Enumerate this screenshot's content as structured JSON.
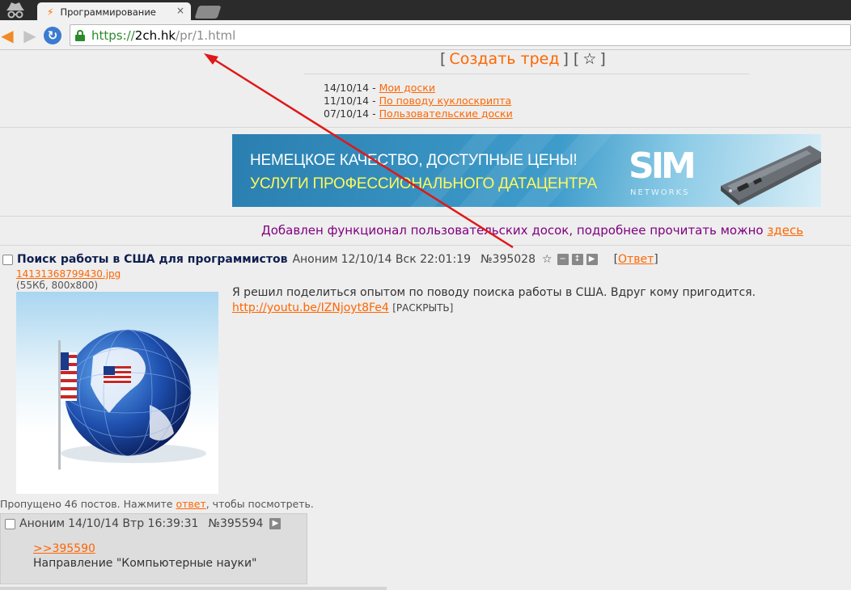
{
  "browser": {
    "tab_title": "Программирование",
    "tab_close": "×",
    "url_scheme": "https://",
    "url_host": "2ch.hk",
    "url_path": "/pr/1.html",
    "icons": {
      "back": "back-arrow-icon",
      "forward": "forward-arrow-icon",
      "reload": "reload-icon",
      "lock": "lock-icon",
      "incognito": "incognito-icon"
    }
  },
  "header": {
    "bracket_open": "[",
    "create_thread": "Создать тред",
    "bracket_mid": "] [",
    "star": "☆",
    "bracket_close": "]"
  },
  "news": [
    {
      "date": "14/10/14 - ",
      "title": "Мои доски"
    },
    {
      "date": "11/10/14 - ",
      "title": "По поводу куклоскрипта"
    },
    {
      "date": "07/10/14 - ",
      "title": "Пользовательские доски"
    }
  ],
  "banner": {
    "line1": "НЕМЕЦКОЕ КАЧЕСТВО, ДОСТУПНЫЕ ЦЕНЫ!",
    "line2": "УСЛУГИ ПРОФЕССИОНАЛЬНОГО ДАТАЦЕНТРА",
    "logo": "SIM",
    "logo_sub": "NETWORKS"
  },
  "announcement": {
    "text": "Добавлен функционал пользовательских досок, подробнее прочитать можно ",
    "link": "здесь"
  },
  "op_post": {
    "subject": "Поиск работы в США для программистов",
    "poster": "Аноним",
    "date": "12/10/14 Вск 22:01:19",
    "number": "№395028",
    "reply_open": "[",
    "reply_label": "Ответ",
    "reply_close": "]",
    "file_name": "14131368799430.jpg",
    "file_info": "(55Кб, 800x800)",
    "text": "Я решил поделиться опытом по поводу поиска работы в США. Вдруг кому пригодится.",
    "link": "http://youtu.be/IZNjoyt8Fe4",
    "expand": "[РАСКРЫТЬ]"
  },
  "omitted": {
    "prefix": "Пропущено 46 постов. Нажмите ",
    "link": "ответ",
    "suffix": ", чтобы посмотреть."
  },
  "reply_post": {
    "poster": "Аноним",
    "date": "14/10/14 Втр 16:39:31",
    "number": "№395594",
    "ref_link": ">>395590",
    "text": "Направление \"Компьютерные науки\""
  },
  "colors": {
    "accent": "#ff6600",
    "subject": "#0f1f4f",
    "announcement": "#800080",
    "arrow": "#e01818"
  }
}
